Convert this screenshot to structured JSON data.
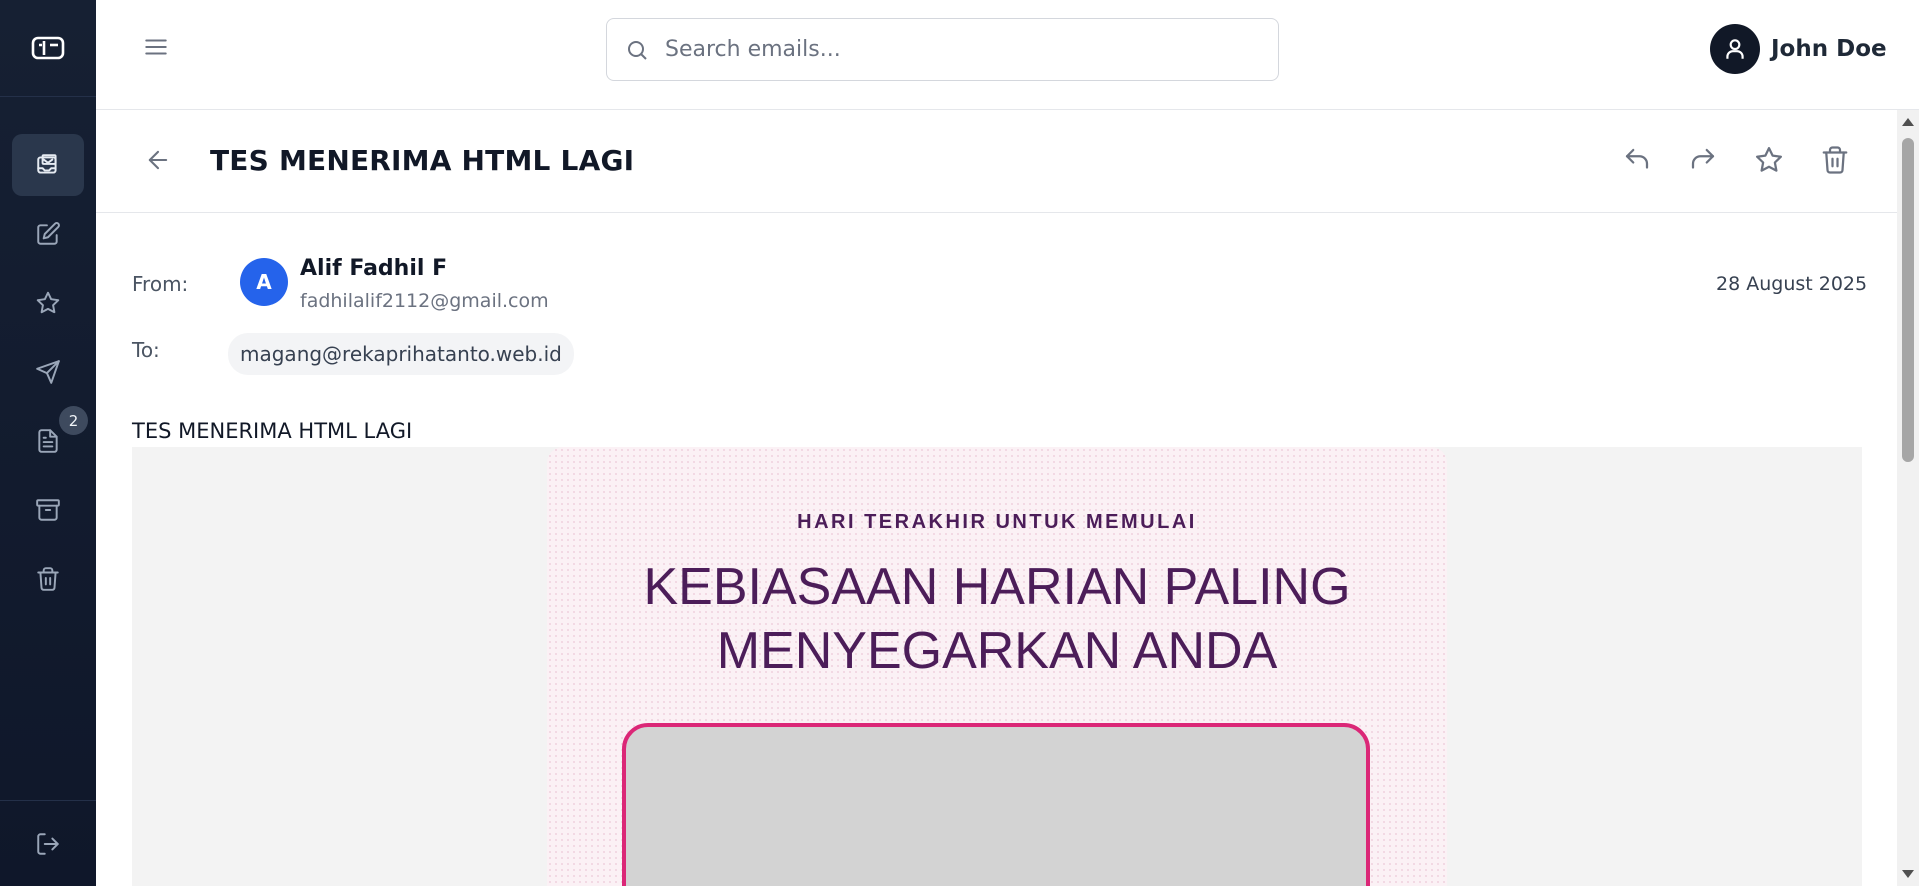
{
  "sidebar": {
    "logo_icon": "mailbox-logo-icon",
    "items": [
      {
        "name": "inbox",
        "icon": "inbox-mail-icon",
        "active": true
      },
      {
        "name": "compose",
        "icon": "pencil-square-icon",
        "active": false
      },
      {
        "name": "starred",
        "icon": "star-icon",
        "active": false
      },
      {
        "name": "sent",
        "icon": "send-icon",
        "active": false
      },
      {
        "name": "drafts",
        "icon": "document-icon",
        "active": false,
        "badge": "2"
      },
      {
        "name": "archive",
        "icon": "archive-icon",
        "active": false
      },
      {
        "name": "trash",
        "icon": "trash-icon",
        "active": false
      }
    ],
    "logout_icon": "logout-icon",
    "colors": {
      "bg": "#0f172a",
      "active_bg": "#2a374c"
    }
  },
  "header": {
    "search_placeholder": "Search emails...",
    "user_name": "John Doe"
  },
  "email": {
    "subject": "TES MENERIMA HTML LAGI",
    "from_label": "From:",
    "to_label": "To:",
    "sender_initial": "A",
    "sender_name": "Alif Fadhil F",
    "sender_email": "fadhilalif2112@gmail.com",
    "date": "28 August 2025",
    "to_address": "magang@rekaprihatanto.web.id",
    "body_text": "TES MENERIMA HTML LAGI",
    "actions": [
      "reply-icon",
      "forward-icon",
      "star-icon",
      "trash-icon"
    ]
  },
  "html_content": {
    "kicker": "HARI TERAKHIR UNTUK MEMULAI",
    "title_line1": "KEBIASAAN HARIAN PALING",
    "title_line2": "MENYEGARKAN ANDA",
    "colors": {
      "title": "#4c1d59",
      "image_border": "#db2777",
      "card_bg": "#fbf1f5"
    }
  }
}
